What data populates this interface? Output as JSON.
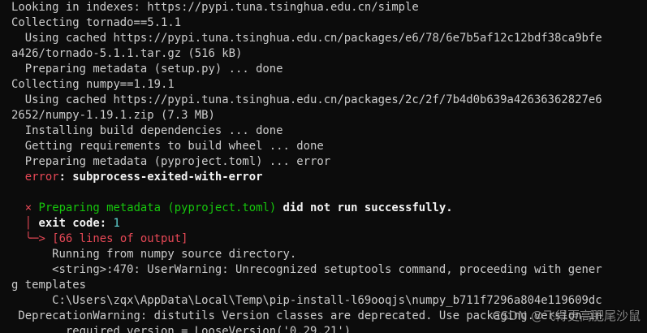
{
  "terminal": {
    "lines": [
      "Looking in indexes: https://pypi.tuna.tsinghua.edu.cn/simple",
      "Collecting tornado==5.1.1",
      "  Using cached https://pypi.tuna.tsinghua.edu.cn/packages/e6/78/6e7b5af12c12bdf38ca9bfe",
      "a426/tornado-5.1.1.tar.gz (516 kB)",
      "  Preparing metadata (setup.py) ... done",
      "Collecting numpy==1.19.1",
      "  Using cached https://pypi.tuna.tsinghua.edu.cn/packages/2c/2f/7b4d0b639a42636362827e6",
      "2652/numpy-1.19.1.zip (7.3 MB)",
      "  Installing build dependencies ... done",
      "  Getting requirements to build wheel ... done",
      "  Preparing metadata (pyproject.toml) ... error"
    ],
    "error_line": {
      "prefix": "error",
      "text": ": subprocess-exited-with-error"
    },
    "failure": {
      "marker": "×",
      "green_text": "Preparing metadata (pyproject.toml)",
      "rest_text": " did not run successfully."
    },
    "exit_code": {
      "pipe": "│",
      "label": "exit code: ",
      "value": "1"
    },
    "output_header": {
      "arrow": "╰─>",
      "text": "[66 lines of output]"
    },
    "output_lines": [
      "      Running from numpy source directory.",
      "      <string>:470: UserWarning: Unrecognized setuptools command, proceeding with gener",
      "g templates",
      "      C:\\Users\\zqx\\AppData\\Local\\Temp\\pip-install-l69ooqjs\\numpy_b711f7296a804e119609dc",
      " DeprecationWarning: distutils Version classes are deprecated. Use packaging.version in",
      "        required_version = LooseVersion('0.29.21')"
    ]
  },
  "watermark": "CSDN @飞得更高肥尾沙鼠"
}
